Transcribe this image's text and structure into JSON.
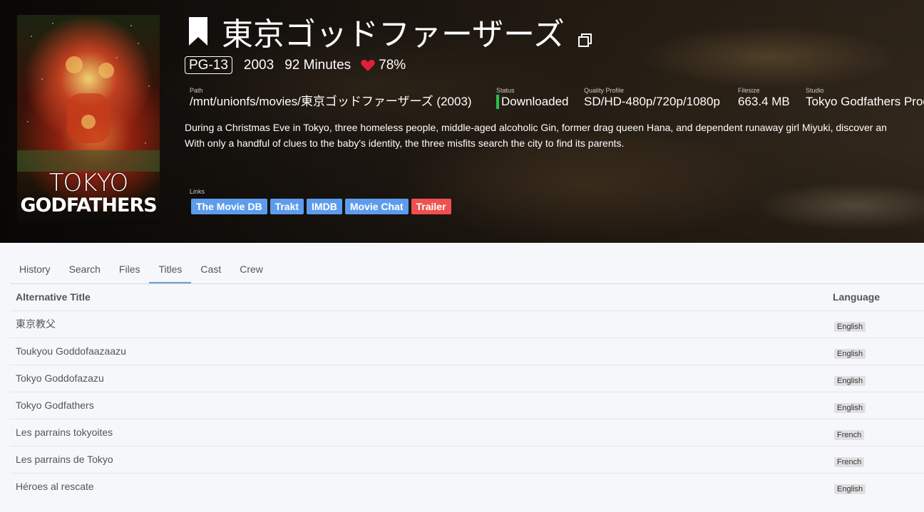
{
  "movie": {
    "title": "東京ゴッドファーザーズ",
    "certification": "PG-13",
    "year": "2003",
    "runtime": "92 Minutes",
    "rating": "78%",
    "overview_line1": "During a Christmas Eve in Tokyo, three homeless people, middle-aged alcoholic Gin, former drag queen Hana, and dependent runaway girl Miyuki, discover an",
    "overview_line2": "With only a handful of clues to the baby's identity, the three misfits search the city to find its parents."
  },
  "poster": {
    "title_line1": "TOKYO",
    "title_line2": "GODFATHERS"
  },
  "details": {
    "path_label": "Path",
    "path": "/mnt/unionfs/movies/東京ゴッドファーザーズ (2003)",
    "status_label": "Status",
    "status": "Downloaded",
    "quality_label": "Quality Profile",
    "quality": "SD/HD-480p/720p/1080p",
    "filesize_label": "Filesize",
    "filesize": "663.4 MB",
    "studio_label": "Studio",
    "studio": "Tokyo Godfathers Prod"
  },
  "links": {
    "label": "Links",
    "items": [
      {
        "label": "The Movie DB",
        "color": "#5d9cec"
      },
      {
        "label": "Trakt",
        "color": "#5d9cec"
      },
      {
        "label": "IMDB",
        "color": "#5d9cec"
      },
      {
        "label": "Movie Chat",
        "color": "#5d9cec"
      },
      {
        "label": "Trailer",
        "color": "#f05050"
      }
    ]
  },
  "tabs": [
    "History",
    "Search",
    "Files",
    "Titles",
    "Cast",
    "Crew"
  ],
  "active_tab": "Titles",
  "table": {
    "headers": {
      "title": "Alternative Title",
      "language": "Language"
    },
    "rows": [
      {
        "title": "東京教父",
        "language": "English"
      },
      {
        "title": "Toukyou Goddofaazaazu",
        "language": "English"
      },
      {
        "title": "Tokyo Goddofazazu",
        "language": "English"
      },
      {
        "title": "Tokyo Godfathers",
        "language": "English"
      },
      {
        "title": "Les parrains tokyoites",
        "language": "French"
      },
      {
        "title": "Les parrains de Tokyo",
        "language": "French"
      },
      {
        "title": "Héroes al rescate",
        "language": "English"
      }
    ]
  },
  "icons": {
    "bookmark": "bookmark-icon",
    "copy": "copy-icon",
    "heart": "heart-icon"
  },
  "colors": {
    "heart": "#e0203a",
    "status_downloaded": "#27c24c",
    "tab_active": "#6f9fd8",
    "link_blue": "#5d9cec",
    "link_red": "#f05050"
  }
}
